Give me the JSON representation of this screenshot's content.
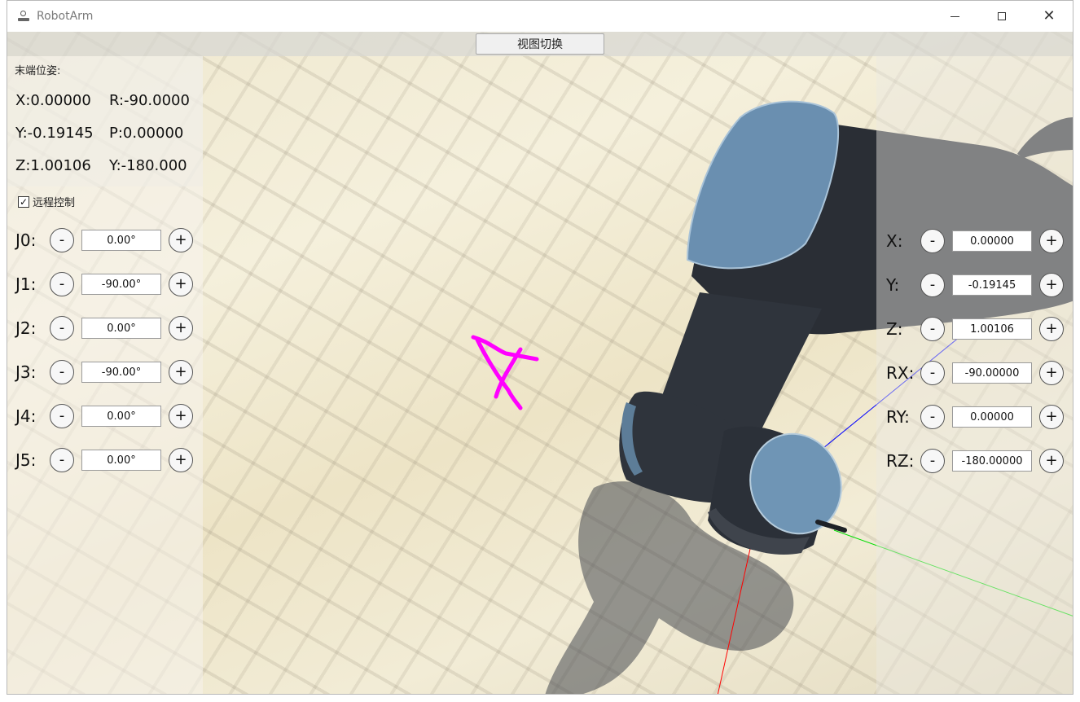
{
  "window": {
    "title": "RobotArm"
  },
  "toolbar": {
    "view_switch_label": "视图切换"
  },
  "pose": {
    "label": "末端位姿:",
    "x": "X:0.00000",
    "r": "R:-90.0000",
    "y": "Y:-0.19145",
    "p": "P:0.00000",
    "z": "Z:1.00106",
    "yaw": "Y:-180.000"
  },
  "remote_control": {
    "label": "远程控制",
    "checked": true
  },
  "joints": [
    {
      "label": "J0:",
      "value": "0.00°"
    },
    {
      "label": "J1:",
      "value": "-90.00°"
    },
    {
      "label": "J2:",
      "value": "0.00°"
    },
    {
      "label": "J3:",
      "value": "-90.00°"
    },
    {
      "label": "J4:",
      "value": "0.00°"
    },
    {
      "label": "J5:",
      "value": "0.00°"
    }
  ],
  "cartesian": [
    {
      "label": "X:",
      "value": "0.00000"
    },
    {
      "label": "Y:",
      "value": "-0.19145"
    },
    {
      "label": "Z:",
      "value": "1.00106"
    },
    {
      "label": "RX:",
      "value": "-90.00000"
    },
    {
      "label": "RY:",
      "value": "0.00000"
    },
    {
      "label": "RZ:",
      "value": "-180.00000"
    }
  ],
  "buttons": {
    "minus": "-",
    "plus": "+"
  },
  "colors": {
    "trace": "#ff00ff",
    "robot_body": "#2b2f36",
    "robot_cap": "#6f95b5",
    "axis_x": "#ff0000",
    "axis_y": "#00dd00",
    "axis_z": "#0000ff"
  }
}
